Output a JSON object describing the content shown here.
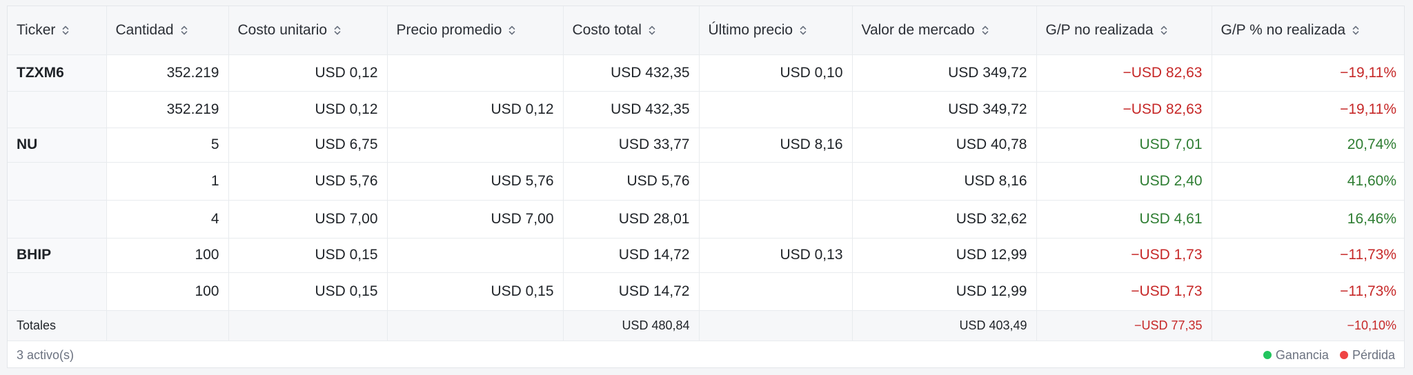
{
  "colors": {
    "negative": "#c62828",
    "positive": "#2e7d32",
    "legend_gain_dot": "#22c55e",
    "legend_loss_dot": "#ef4444"
  },
  "table": {
    "headers": [
      "Ticker",
      "Cantidad",
      "Costo unitario",
      "Precio promedio",
      "Costo total",
      "Último precio",
      "Valor de mercado",
      "G/P no realizada",
      "G/P % no realizada"
    ],
    "rows": [
      [
        "TZXM6",
        "352.219",
        "USD 0,12",
        "",
        "USD 432,35",
        "USD 0,10",
        "USD 349,72",
        "−USD 82,63",
        "−19,11%"
      ],
      [
        "",
        "352.219",
        "USD 0,12",
        "USD 0,12",
        "USD 432,35",
        "",
        "USD 349,72",
        "−USD 82,63",
        "−19,11%"
      ],
      [
        "NU",
        "5",
        "USD 6,75",
        "",
        "USD 33,77",
        "USD 8,16",
        "USD 40,78",
        "USD 7,01",
        "20,74%"
      ],
      [
        "",
        "1",
        "USD 5,76",
        "USD 5,76",
        "USD 5,76",
        "",
        "USD 8,16",
        "USD 2,40",
        "41,60%"
      ],
      [
        "",
        "4",
        "USD 7,00",
        "USD 7,00",
        "USD 28,01",
        "",
        "USD 32,62",
        "USD 4,61",
        "16,46%"
      ],
      [
        "BHIP",
        "100",
        "USD 0,15",
        "",
        "USD 14,72",
        "USD 0,13",
        "USD 12,99",
        "−USD 1,73",
        "−11,73%"
      ],
      [
        "",
        "100",
        "USD 0,15",
        "USD 0,15",
        "USD 14,72",
        "",
        "USD 12,99",
        "−USD 1,73",
        "−11,73%"
      ]
    ],
    "totals": [
      "Totales",
      "",
      "",
      "",
      "USD 480,84",
      "",
      "USD 403,49",
      "−USD 77,35",
      "−10,10%"
    ]
  },
  "footer": {
    "count": "3 activo(s)",
    "legend_gain": "Ganancia",
    "legend_loss": "Pérdida"
  }
}
